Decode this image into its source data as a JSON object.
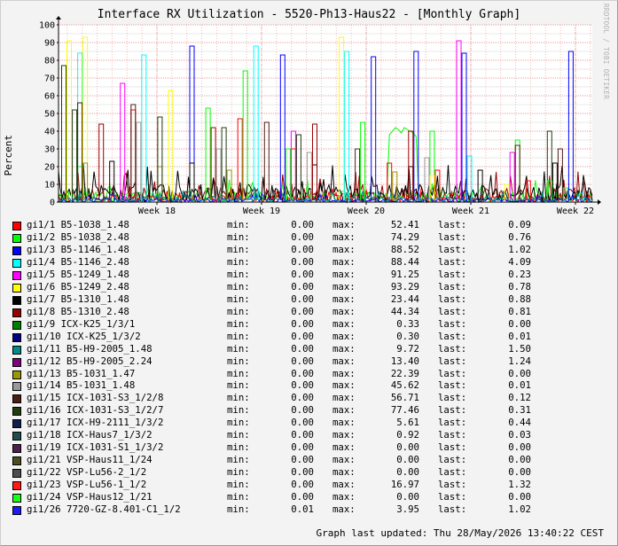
{
  "title": "Interface RX Utilization - 5520-Ph13-Haus22 - [Monthly Graph]",
  "side_text": "RRDTOOL / TOBI OETIKER",
  "updated": "Graph last updated: Thu 28/May/2026 13:40:22 CEST",
  "labels": {
    "min": "min:",
    "max": "max:",
    "last": "last:"
  },
  "chart_data": {
    "type": "line",
    "ylabel": "Percent",
    "ylim": [
      0,
      100
    ],
    "yticks": [
      "0",
      "10",
      "20",
      "30",
      "40",
      "50",
      "60",
      "70",
      "80",
      "90",
      "100"
    ],
    "xtick_labels": [
      "Week 18",
      "Week 19",
      "Week 20",
      "Week 21",
      "Week 22"
    ],
    "grid": true,
    "series": [
      {
        "name": "gi1/1 B5-1038_1.48",
        "color": "#ff0000",
        "min": "0.00",
        "max": "52.41",
        "last": "0.09"
      },
      {
        "name": "gi1/2 B5-1038_2.48",
        "color": "#00ff00",
        "min": "0.00",
        "max": "74.29",
        "last": "0.76"
      },
      {
        "name": "gi1/3 B5-1146_1.48",
        "color": "#0000ff",
        "min": "0.00",
        "max": "88.52",
        "last": "1.02"
      },
      {
        "name": "gi1/4 B5-1146_2.48",
        "color": "#00ffff",
        "min": "0.00",
        "max": "88.44",
        "last": "4.09"
      },
      {
        "name": "gi1/5 B5-1249_1.48",
        "color": "#ff00ff",
        "min": "0.00",
        "max": "91.25",
        "last": "0.23"
      },
      {
        "name": "gi1/6 B5-1249_2.48",
        "color": "#ffff00",
        "min": "0.00",
        "max": "93.29",
        "last": "0.78"
      },
      {
        "name": "gi1/7 B5-1310_1.48",
        "color": "#000000",
        "min": "0.00",
        "max": "23.44",
        "last": "0.88"
      },
      {
        "name": "gi1/8 B5-1310_2.48",
        "color": "#990000",
        "min": "0.00",
        "max": "44.34",
        "last": "0.81"
      },
      {
        "name": "gi1/9 ICX-K25_1/3/1",
        "color": "#008000",
        "min": "0.00",
        "max": "0.33",
        "last": "0.00"
      },
      {
        "name": "gi1/10 ICX-K25_1/3/2",
        "color": "#000080",
        "min": "0.00",
        "max": "0.30",
        "last": "0.01"
      },
      {
        "name": "gi1/11 B5-H9-2005_1.48",
        "color": "#008b8b",
        "min": "0.00",
        "max": "9.72",
        "last": "1.50"
      },
      {
        "name": "gi1/12 B5-H9-2005_2.24",
        "color": "#800080",
        "min": "0.00",
        "max": "13.40",
        "last": "1.24"
      },
      {
        "name": "gi1/13 B5-1031_1.47",
        "color": "#999900",
        "min": "0.00",
        "max": "22.39",
        "last": "0.00"
      },
      {
        "name": "gi1/14 B5-1031_1.48",
        "color": "#999999",
        "min": "0.00",
        "max": "45.62",
        "last": "0.01"
      },
      {
        "name": "gi1/15 ICX-1031-S3_1/2/8",
        "color": "#4d1f14",
        "min": "0.00",
        "max": "56.71",
        "last": "0.12"
      },
      {
        "name": "gi1/16 ICX-1031-S3_1/2/7",
        "color": "#1f3d0f",
        "min": "0.00",
        "max": "77.46",
        "last": "0.31"
      },
      {
        "name": "gi1/17 ICX-H9-2111_1/3/2",
        "color": "#0f1f4d",
        "min": "0.00",
        "max": "5.61",
        "last": "0.44"
      },
      {
        "name": "gi1/18 ICX-Haus7_1/3/2",
        "color": "#1f4d4d",
        "min": "0.00",
        "max": "0.92",
        "last": "0.03"
      },
      {
        "name": "gi1/19 ICX-1031-S1_1/3/2",
        "color": "#4d1f4d",
        "min": "0.00",
        "max": "0.00",
        "last": "0.00"
      },
      {
        "name": "gi1/21 VSP-Haus11_1/24",
        "color": "#4d4d1f",
        "min": "0.00",
        "max": "0.00",
        "last": "0.00"
      },
      {
        "name": "gi1/22 VSP-Lu56-2_1/2",
        "color": "#4d4d4d",
        "min": "0.00",
        "max": "0.00",
        "last": "0.00"
      },
      {
        "name": "gi1/23 VSP-Lu56-1_1/2",
        "color": "#ff1a1a",
        "min": "0.00",
        "max": "16.97",
        "last": "1.32"
      },
      {
        "name": "gi1/24 VSP-Haus12_1/21",
        "color": "#1aff1a",
        "min": "0.00",
        "max": "0.00",
        "last": "0.00"
      },
      {
        "name": "gi1/26 7720-GZ-8.401-C1_1/2",
        "color": "#1a1aff",
        "min": "0.01",
        "max": "3.95",
        "last": "1.02"
      }
    ],
    "spikes": [
      {
        "s": 0,
        "xs": [
          0.14,
          0.34,
          0.44,
          0.62,
          0.71,
          0.88
        ],
        "ys": [
          52,
          47,
          30,
          22,
          18,
          12
        ]
      },
      {
        "s": 1,
        "xs": [
          0.04,
          0.28,
          0.35,
          0.43,
          0.57,
          0.7,
          0.86
        ],
        "ys": [
          20,
          53,
          74,
          30,
          45,
          40,
          35
        ]
      },
      {
        "s": 2,
        "xs": [
          0.25,
          0.42,
          0.59,
          0.67,
          0.76,
          0.96
        ],
        "ys": [
          88,
          83,
          82,
          85,
          84,
          85
        ]
      },
      {
        "s": 3,
        "xs": [
          0.04,
          0.16,
          0.37,
          0.54,
          0.77,
          0.98
        ],
        "ys": [
          84,
          83,
          88,
          85,
          26,
          5
        ]
      },
      {
        "s": 4,
        "xs": [
          0.12,
          0.44,
          0.75,
          0.85
        ],
        "ys": [
          67,
          40,
          91,
          28
        ]
      },
      {
        "s": 5,
        "xs": [
          0.02,
          0.05,
          0.21,
          0.53,
          0.7,
          0.84
        ],
        "ys": [
          91,
          93,
          63,
          93,
          15,
          10
        ]
      },
      {
        "s": 6,
        "xs": [
          0.1,
          0.25,
          0.48,
          0.66,
          0.79,
          0.93
        ],
        "ys": [
          23,
          22,
          21,
          20,
          18,
          22
        ]
      },
      {
        "s": 7,
        "xs": [
          0.08,
          0.29,
          0.48,
          0.66
        ],
        "ys": [
          44,
          42,
          44,
          40
        ]
      },
      {
        "s": 12,
        "xs": [
          0.05,
          0.19,
          0.32,
          0.63
        ],
        "ys": [
          22,
          20,
          18,
          17
        ]
      },
      {
        "s": 13,
        "xs": [
          0.15,
          0.3,
          0.47,
          0.69
        ],
        "ys": [
          45,
          30,
          28,
          25
        ]
      },
      {
        "s": 14,
        "xs": [
          0.04,
          0.14,
          0.39,
          0.56,
          0.86,
          0.94
        ],
        "ys": [
          56,
          55,
          45,
          30,
          32,
          30
        ]
      },
      {
        "s": 15,
        "xs": [
          0.01,
          0.03,
          0.19,
          0.31,
          0.45,
          0.92
        ],
        "ys": [
          77,
          52,
          48,
          42,
          38,
          40
        ]
      },
      {
        "s": 22,
        "xs": [
          0.92,
          0.95
        ],
        "ys": [
          12,
          8
        ]
      },
      {
        "s": 23,
        "xs": [
          0.1,
          0.5,
          0.9
        ],
        "ys": [
          4,
          3,
          3
        ]
      }
    ],
    "plateau": {
      "s": 1,
      "x0": 0.62,
      "x1": 0.67,
      "ys": [
        38,
        40,
        42,
        41,
        39,
        42,
        41,
        40,
        39,
        37
      ]
    },
    "baseline": [
      {
        "s": 7,
        "level": 8
      },
      {
        "s": 22,
        "level": 6
      },
      {
        "s": 0,
        "level": 4
      },
      {
        "s": 6,
        "level": 10
      },
      {
        "s": 2,
        "level": 2
      },
      {
        "s": 10,
        "level": 3
      }
    ]
  }
}
